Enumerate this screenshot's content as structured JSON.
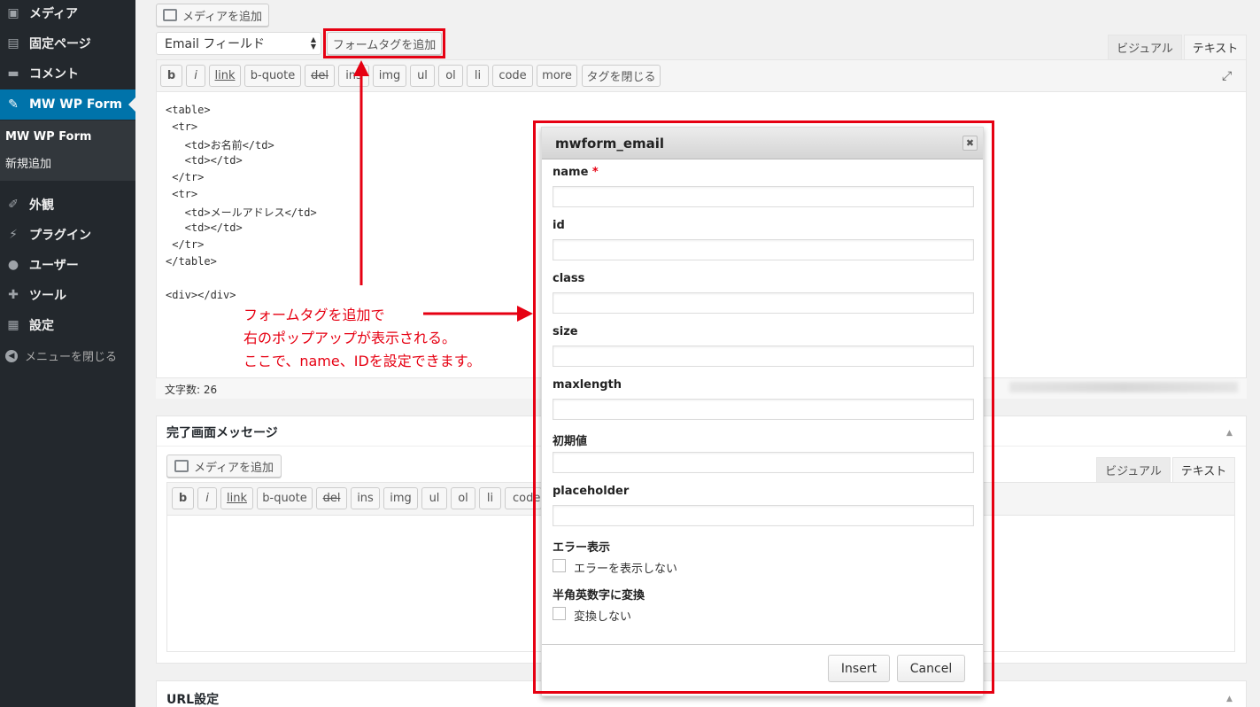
{
  "sidebar": {
    "items": [
      {
        "label": "メディア",
        "icon": "media-icon"
      },
      {
        "label": "固定ページ",
        "icon": "page-icon"
      },
      {
        "label": "コメント",
        "icon": "comment-icon"
      },
      {
        "label": "MW WP Form",
        "icon": "pin-icon"
      },
      {
        "label": "外観",
        "icon": "brush-icon"
      },
      {
        "label": "プラグイン",
        "icon": "plugin-icon"
      },
      {
        "label": "ユーザー",
        "icon": "user-icon"
      },
      {
        "label": "ツール",
        "icon": "wrench-icon"
      },
      {
        "label": "設定",
        "icon": "settings-icon"
      }
    ],
    "submenu": [
      "MW WP Form",
      "新規追加"
    ],
    "collapse_label": "メニューを閉じる"
  },
  "editor1": {
    "media_button": "メディアを追加",
    "field_select": "Email フィールド",
    "add_tag_button": "フォームタグを追加",
    "tabs": [
      "ビジュアル",
      "テキスト"
    ],
    "quicktags": [
      "b",
      "i",
      "link",
      "b-quote",
      "del",
      "ins",
      "img",
      "ul",
      "ol",
      "li",
      "code",
      "more",
      "タグを閉じる"
    ],
    "code_lines": [
      "<table>",
      " <tr>",
      "   <td>お名前</td>",
      "   <td></td>",
      " </tr>",
      " <tr>",
      "   <td>メールアドレス</td>",
      "   <td></td>",
      " </tr>",
      "</table>",
      "",
      "<div></div>"
    ],
    "word_count": "文字数: 26"
  },
  "annotation": {
    "lines": [
      "フォームタグを追加で",
      "右のポップアップが表示される。",
      "ここで、name、IDを設定できます。"
    ],
    "color": "#e60012"
  },
  "panel_complete": {
    "title": "完了画面メッセージ",
    "media_button": "メディアを追加",
    "tabs": [
      "ビジュアル",
      "テキスト"
    ],
    "quicktags": [
      "b",
      "i",
      "link",
      "b-quote",
      "del",
      "ins",
      "img",
      "ul",
      "ol",
      "li",
      "code"
    ]
  },
  "panel_url": {
    "title": "URL設定"
  },
  "modal": {
    "title": "mwform_email",
    "fields": [
      {
        "label": "name",
        "required": "*",
        "value": ""
      },
      {
        "label": "id",
        "value": ""
      },
      {
        "label": "class",
        "value": ""
      },
      {
        "label": "size",
        "value": ""
      },
      {
        "label": "maxlength",
        "value": ""
      },
      {
        "label": "初期値",
        "value": ""
      },
      {
        "label": "placeholder",
        "value": ""
      }
    ],
    "error_section": {
      "label": "エラー表示",
      "checkbox": "エラーを表示しない",
      "checked": false
    },
    "convert_section": {
      "label": "半角英数字に変換",
      "checkbox": "変換しない",
      "checked": false
    },
    "insert_button": "Insert",
    "cancel_button": "Cancel"
  },
  "colors": {
    "sidebar_bg": "#23282d",
    "active": "#0073aa",
    "highlight": "#e60012"
  }
}
